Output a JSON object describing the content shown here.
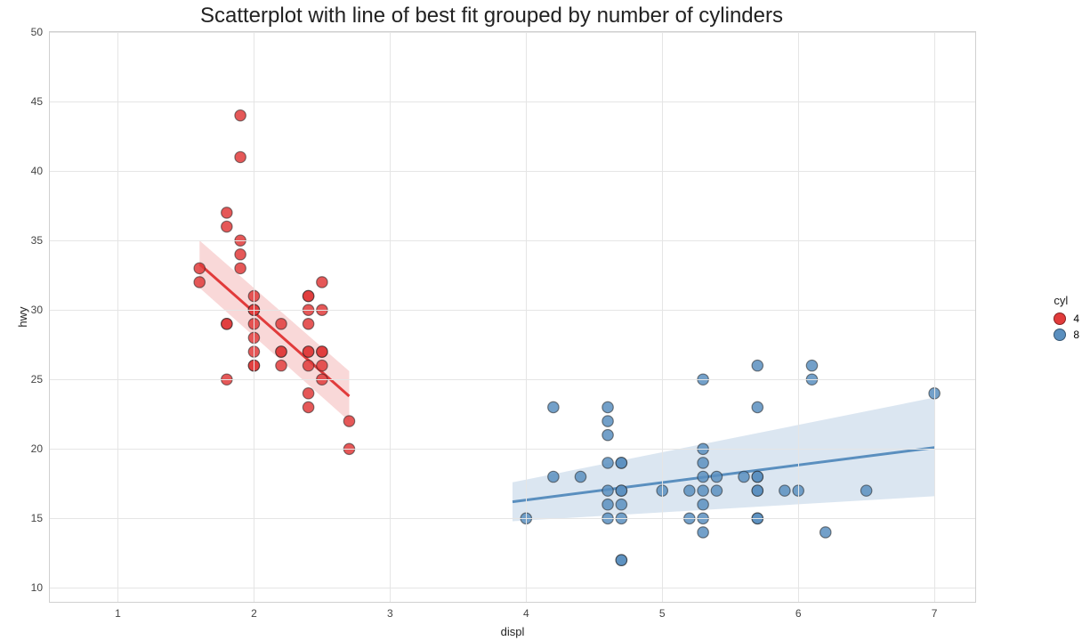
{
  "chart_data": {
    "type": "scatter",
    "title": "Scatterplot with line of best fit grouped by number of cylinders",
    "xlabel": "displ",
    "ylabel": "hwy",
    "xlim": [
      0.5,
      7.3
    ],
    "ylim": [
      9,
      50
    ],
    "xticks": [
      1,
      2,
      3,
      4,
      5,
      6,
      7
    ],
    "yticks": [
      10,
      15,
      20,
      25,
      30,
      35,
      40,
      45,
      50
    ],
    "legend_title": "cyl",
    "series": [
      {
        "name": "4",
        "color": "#e13b3b",
        "band_color": "rgba(225,59,59,0.20)",
        "points": [
          [
            1.6,
            33
          ],
          [
            1.6,
            32
          ],
          [
            1.8,
            36
          ],
          [
            1.8,
            37
          ],
          [
            1.8,
            29
          ],
          [
            1.8,
            29
          ],
          [
            1.8,
            25
          ],
          [
            1.9,
            44
          ],
          [
            1.9,
            41
          ],
          [
            1.9,
            35
          ],
          [
            1.9,
            34
          ],
          [
            1.9,
            33
          ],
          [
            2.0,
            30
          ],
          [
            2.0,
            30
          ],
          [
            2.0,
            31
          ],
          [
            2.0,
            29
          ],
          [
            2.0,
            28
          ],
          [
            2.0,
            27
          ],
          [
            2.0,
            26
          ],
          [
            2.0,
            26
          ],
          [
            2.2,
            29
          ],
          [
            2.2,
            27
          ],
          [
            2.2,
            27
          ],
          [
            2.2,
            26
          ],
          [
            2.4,
            31
          ],
          [
            2.4,
            31
          ],
          [
            2.4,
            30
          ],
          [
            2.4,
            29
          ],
          [
            2.4,
            27
          ],
          [
            2.4,
            27
          ],
          [
            2.4,
            26
          ],
          [
            2.4,
            24
          ],
          [
            2.4,
            23
          ],
          [
            2.5,
            32
          ],
          [
            2.5,
            30
          ],
          [
            2.5,
            27
          ],
          [
            2.5,
            27
          ],
          [
            2.5,
            26
          ],
          [
            2.5,
            25
          ],
          [
            2.7,
            22
          ],
          [
            2.7,
            20
          ]
        ],
        "trend": {
          "x1": 1.6,
          "y1": 33.3,
          "x2": 2.7,
          "y2": 23.8
        },
        "band": {
          "x1": 1.6,
          "x2": 2.7,
          "y1_top": 35.0,
          "y2_top": 25.6,
          "y1_bot": 31.6,
          "y2_bot": 22.0
        }
      },
      {
        "name": "8",
        "color": "#5a8fbf",
        "band_color": "rgba(90,143,191,0.22)",
        "points": [
          [
            4.0,
            15
          ],
          [
            4.2,
            23
          ],
          [
            4.2,
            18
          ],
          [
            4.4,
            18
          ],
          [
            4.6,
            23
          ],
          [
            4.6,
            22
          ],
          [
            4.6,
            21
          ],
          [
            4.6,
            19
          ],
          [
            4.6,
            17
          ],
          [
            4.6,
            16
          ],
          [
            4.6,
            15
          ],
          [
            4.7,
            19
          ],
          [
            4.7,
            19
          ],
          [
            4.7,
            17
          ],
          [
            4.7,
            17
          ],
          [
            4.7,
            16
          ],
          [
            4.7,
            15
          ],
          [
            4.7,
            12
          ],
          [
            4.7,
            12
          ],
          [
            5.0,
            17
          ],
          [
            5.2,
            17
          ],
          [
            5.2,
            15
          ],
          [
            5.3,
            25
          ],
          [
            5.3,
            20
          ],
          [
            5.3,
            19
          ],
          [
            5.3,
            18
          ],
          [
            5.3,
            17
          ],
          [
            5.3,
            16
          ],
          [
            5.3,
            15
          ],
          [
            5.3,
            14
          ],
          [
            5.4,
            18
          ],
          [
            5.4,
            17
          ],
          [
            5.6,
            18
          ],
          [
            5.7,
            26
          ],
          [
            5.7,
            23
          ],
          [
            5.7,
            18
          ],
          [
            5.7,
            18
          ],
          [
            5.7,
            17
          ],
          [
            5.7,
            17
          ],
          [
            5.7,
            15
          ],
          [
            5.7,
            15
          ],
          [
            5.9,
            17
          ],
          [
            6.0,
            17
          ],
          [
            6.1,
            26
          ],
          [
            6.1,
            25
          ],
          [
            6.2,
            14
          ],
          [
            6.5,
            17
          ],
          [
            7.0,
            24
          ]
        ],
        "trend": {
          "x1": 3.9,
          "y1": 16.2,
          "x2": 7.0,
          "y2": 20.1
        },
        "band": {
          "x1": 3.9,
          "x2": 7.0,
          "y1_top": 17.6,
          "y2_top": 23.7,
          "y1_bot": 14.8,
          "y2_bot": 16.6
        }
      }
    ]
  }
}
